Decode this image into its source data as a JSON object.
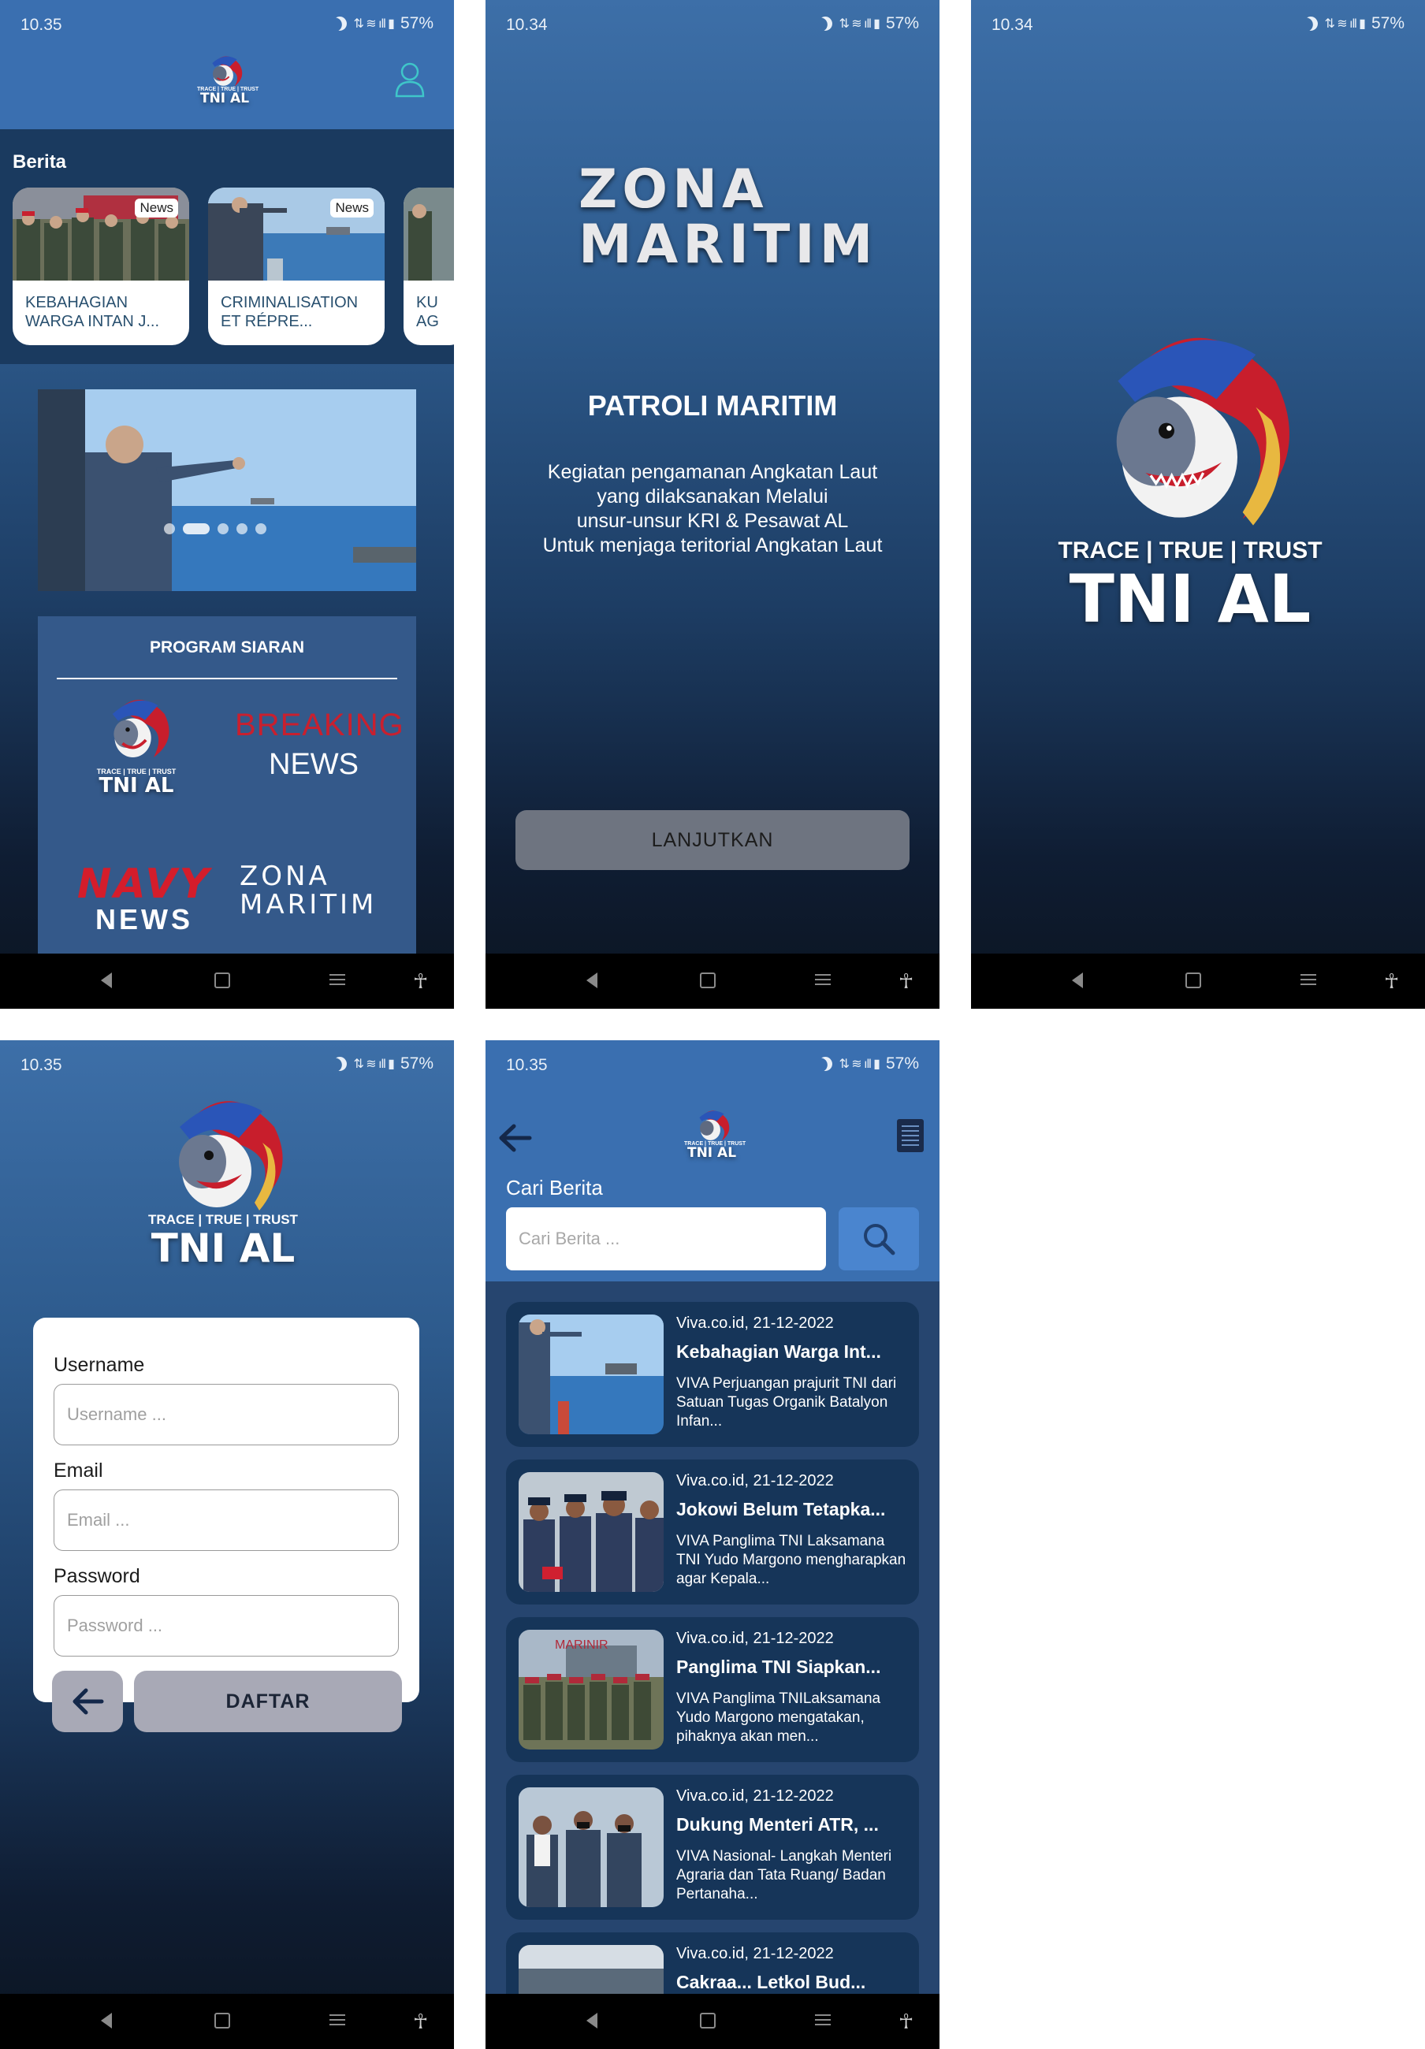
{
  "status": {
    "time_a": "10.35",
    "time_b": "10.34",
    "battery": "57%"
  },
  "logo": {
    "tagline": "TRACE | TRUE | TRUST",
    "name": "TNI AL"
  },
  "home": {
    "section_title": "Berita",
    "news_cards": [
      {
        "tag": "News",
        "title": "KEBAHAGIAN WARGA INTAN J..."
      },
      {
        "tag": "News",
        "title": "CRIMINALISATION ET RÉPRE..."
      },
      {
        "tag": "",
        "title": "KU AG"
      }
    ],
    "program_title": "PROGRAM SIARAN",
    "programs": {
      "breaking_1": "BREAKING",
      "breaking_2": "NEWS",
      "navy_1": "NAVY",
      "navy_2": "NEWS",
      "zona_1": "ZONA",
      "zona_2": "MARITIM"
    }
  },
  "intro": {
    "brand_1": "ZONA",
    "brand_2": "MARITIM",
    "title": "PATROLI MARITIM",
    "description": [
      "Kegiatan pengamanan Angkatan Laut",
      "yang dilaksanakan Melalui",
      "unsur-unsur KRI & Pesawat AL",
      "Untuk menjaga teritorial Angkatan Laut"
    ],
    "continue_label": "LANJUTKAN"
  },
  "register": {
    "username_label": "Username",
    "username_placeholder": "Username ...",
    "email_label": "Email",
    "email_placeholder": "Email ...",
    "password_label": "Password",
    "password_placeholder": "Password ...",
    "submit_label": "DAFTAR"
  },
  "search": {
    "label": "Cari Berita",
    "placeholder": "Cari Berita ...",
    "results": [
      {
        "source": "Viva.co.id, 21-12-2022",
        "title": "Kebahagian Warga Int...",
        "desc": "VIVA  Perjuangan prajurit TNI dari Satuan Tugas Organik Batalyon Infan..."
      },
      {
        "source": "Viva.co.id, 21-12-2022",
        "title": "Jokowi Belum Tetapka...",
        "desc": "VIVA  Panglima TNI Laksamana TNI Yudo Margono mengharapkan agar Kepala..."
      },
      {
        "source": "Viva.co.id, 21-12-2022",
        "title": "Panglima TNI Siapkan...",
        "desc": "VIVA  Panglima TNILaksamana Yudo Margono mengatakan, pihaknya akan men..."
      },
      {
        "source": "Viva.co.id, 21-12-2022",
        "title": "Dukung Menteri ATR, ...",
        "desc": "VIVA Nasional- Langkah Menteri Agraria dan Tata Ruang/ Badan Pertanaha..."
      },
      {
        "source": "Viva.co.id, 21-12-2022",
        "title": "Cakraa... Letkol Bud...",
        "desc": ""
      }
    ],
    "thumb_overlay_text": "MARINIR"
  },
  "colors": {
    "header_blue": "#3a6fb0",
    "card_dark": "#163559",
    "brand_red": "#d41d2b"
  }
}
